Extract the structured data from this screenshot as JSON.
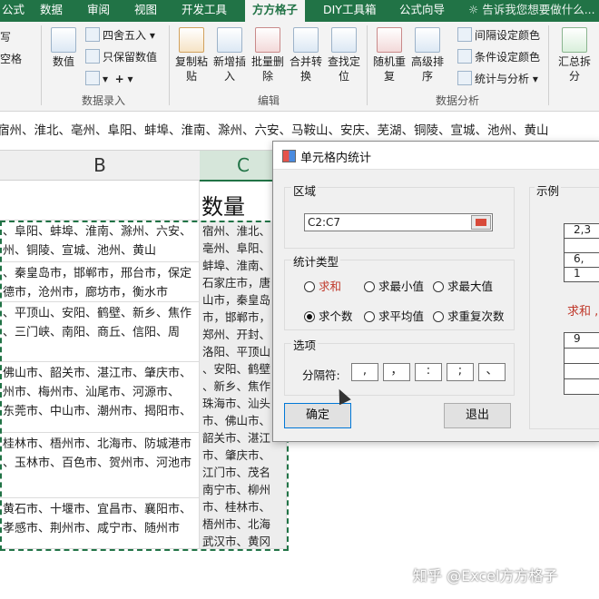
{
  "ribbon": {
    "tabs": [
      "公式",
      "数据",
      "审阅",
      "视图",
      "开发工具",
      "方方格子",
      "DIY工具箱",
      "公式向导"
    ],
    "active_tab": "方方格子",
    "tell_me": "告诉我您想要做什么...",
    "left_cut": [
      "写",
      "空格"
    ],
    "numeric_big": "数值",
    "round": "四舍五入",
    "keep_value": "只保留数值",
    "plus": "+",
    "group_data_entry": "数据录入",
    "paste": "复制粘\n贴",
    "insert": "新增插\n入",
    "batch_delete": "批量删\n除",
    "merge": "合并转\n换",
    "find": "查找定\n位",
    "group_edit": "编辑",
    "random_repeat": "随机重\n复",
    "advanced_sort": "高级排\n序",
    "interval_color": "间隔设定颜色",
    "cond_color": "条件设定颜色",
    "stat_analysis": "统计与分析",
    "group_data_analysis": "数据分析",
    "summary_split": "汇总拆\n分"
  },
  "formula_bar": "宿州、淮北、亳州、阜阳、蚌埠、淮南、滁州、六安、马鞍山、安庆、芜湖、铜陵、宣城、池州、黄山",
  "grid": {
    "col_b": "B",
    "col_c": "C",
    "header_c": "数量",
    "b_cells": [
      "、阜阳、蚌埠、淮南、滁州、六安、\n州、铜陵、宣城、池州、黄山",
      "、秦皇岛市，邯郸市，邢台市，保定\n德市，沧州市，廊坊市，衡水市",
      "、平顶山、安阳、鹤壁、新乡、焦作\n、三门峡、南阳、商丘、信阳、周",
      "佛山市、韶关市、湛江市、肇庆市、\n州市、梅州市、汕尾市、河源市、\n东莞市、中山市、潮州市、揭阳市、",
      "桂林市、梧州市、北海市、防城港市\n、玉林市、百色市、贺州市、河池市",
      "黄石市、十堰市、宜昌市、襄阳市、\n孝感市、荆州市、咸宁市、随州市"
    ],
    "c_text": "宿州、淮北、\n亳州、阜阳、\n蚌埠、淮南、\n石家庄市，唐\n山市，秦皇岛\n市，邯郸市，\n郑州、开封、\n洛阳、平顶山\n、安阳、鹤壁\n、新乡、焦作\n珠海市、汕头\n市、佛山市、\n韶关市、湛江\n市、肇庆市、\n江门市、茂名\n南宁市、柳州\n市、桂林市、\n梧州市、北海\n武汉市、黄冈\n市、黄石市、\n十堰市、宜昌\n市、襄阳市、"
  },
  "dialog": {
    "title": "单元格内统计",
    "section_range": "区域",
    "range_value": "C2:C7",
    "section_type": "统计类型",
    "opt_sum": "求和",
    "opt_min": "求最小值",
    "opt_max": "求最大值",
    "opt_count": "求个数",
    "opt_avg": "求平均值",
    "opt_dup": "求重复次数",
    "section_options": "选项",
    "sep_label": "分隔符:",
    "separators": [
      ",",
      "，",
      ":",
      ";",
      "、"
    ],
    "ok": "确定",
    "exit": "退出",
    "section_example": "示例",
    "ex_rows": [
      "2,3",
      "",
      "6,",
      "1",
      "9",
      ""
    ],
    "ex_red": "求和 ,"
  },
  "watermark": "知乎 @Excel方方格子"
}
